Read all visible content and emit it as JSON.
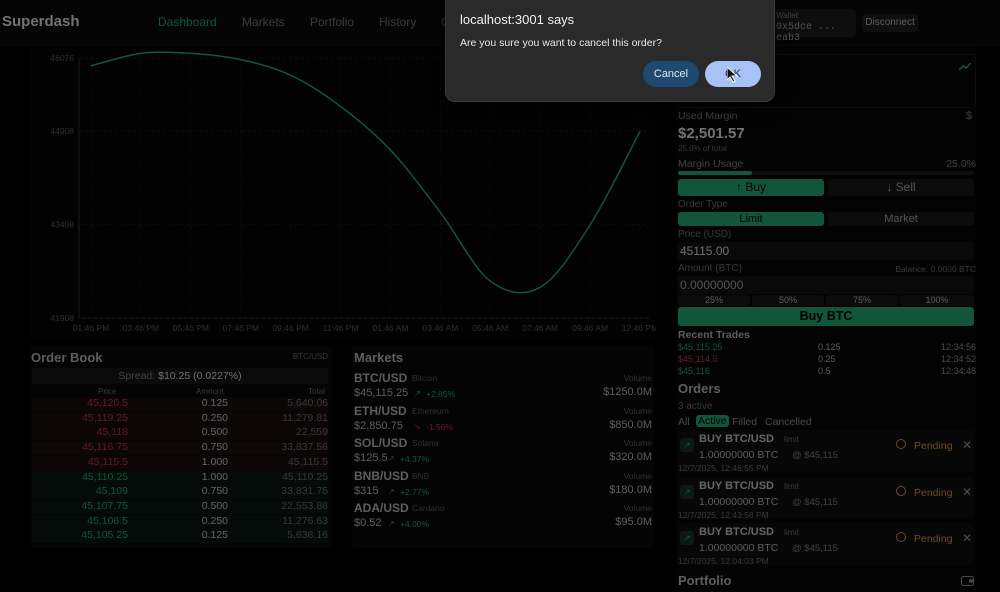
{
  "header": {
    "brand": "Superdash",
    "nav": [
      "Dashboard",
      "Markets",
      "Portfolio",
      "History",
      "G"
    ],
    "wallet_label": "Wallet",
    "wallet_addr": "0x5dce ... eab3",
    "disconnect": "Disconnect"
  },
  "chart": {
    "yticks": [
      "46076",
      "44908",
      "43408",
      "41908"
    ],
    "xticks": [
      "01:46 PM",
      "03:46 PM",
      "05:46 PM",
      "07:46 PM",
      "09:46 PM",
      "11:46 PM",
      "01:46 AM",
      "03:46 AM",
      "05:46 AM",
      "07:46 AM",
      "09:46 AM",
      "12:46 PM"
    ]
  },
  "chart_data": {
    "type": "line",
    "x": [
      "01:46 PM",
      "03:46 PM",
      "05:46 PM",
      "07:46 PM",
      "09:46 PM",
      "11:46 PM",
      "01:46 AM",
      "03:46 AM",
      "05:46 AM",
      "07:46 AM",
      "09:46 AM",
      "12:46 PM"
    ],
    "series": [
      {
        "values": [
          45950,
          46150,
          46150,
          46050,
          45800,
          45300,
          44600,
          43600,
          42500,
          42400,
          43400,
          44900
        ]
      }
    ],
    "ylim": [
      41908,
      46076
    ]
  },
  "orderbook": {
    "title": "Order Book",
    "pair": "BTC/USD",
    "spread_label": "Spread:",
    "spread": "$10.25 (0.0227%)",
    "cols": [
      "Price",
      "Amount",
      "Total"
    ],
    "asks": [
      [
        "45,120.5",
        "0.125",
        "5,640.06"
      ],
      [
        "45,119.25",
        "0.250",
        "11,279.81"
      ],
      [
        "45,118",
        "0.500",
        "22,559"
      ],
      [
        "45,116.75",
        "0.750",
        "33,837.56"
      ],
      [
        "45,115.5",
        "1.000",
        "45,115.5"
      ]
    ],
    "bids": [
      [
        "45,110.25",
        "1.000",
        "45,110.25"
      ],
      [
        "45,109",
        "0.750",
        "33,831.75"
      ],
      [
        "45,107.75",
        "0.500",
        "22,553.88"
      ],
      [
        "45,106.5",
        "0.250",
        "11,276.63"
      ],
      [
        "45,105.25",
        "0.125",
        "5,638.16"
      ]
    ]
  },
  "markets": {
    "title": "Markets",
    "vol_label": "Volume",
    "items": [
      {
        "sym": "BTC/USD",
        "name": "Bitcoin",
        "price": "$45,115.25",
        "chg": "+2.85%",
        "vol": "$1250.0M",
        "up": true
      },
      {
        "sym": "ETH/USD",
        "name": "Ethereum",
        "price": "$2,850.75",
        "chg": "-1.56%",
        "vol": "$850.0M",
        "up": false
      },
      {
        "sym": "SOL/USD",
        "name": "Solana",
        "price": "$125.5",
        "chg": "+4.37%",
        "vol": "$320.0M",
        "up": true
      },
      {
        "sym": "BNB/USD",
        "name": "BNB",
        "price": "$315",
        "chg": "+2.77%",
        "vol": "$180.0M",
        "up": true
      },
      {
        "sym": "ADA/USD",
        "name": "Cardano",
        "price": "$0.52",
        "chg": "+4.00%",
        "vol": "$95.0M",
        "up": true
      }
    ]
  },
  "trade": {
    "used_margin_label": "Used Margin",
    "used_margin": "$2,501.57",
    "pct_total": "25.0% of total",
    "margin_usage_label": "Margin Usage",
    "margin_usage": "25.0%",
    "margin_fill": 0.25,
    "buy": "Buy",
    "sell": "Sell",
    "order_type": "Order Type",
    "limit": "Limit",
    "market": "Market",
    "price_label": "Price (USD)",
    "price": "45115.00",
    "amount_label": "Amount (BTC)",
    "balance": "Balance: 0.0000 BTC",
    "amount": "0.00000000",
    "pcts": [
      "25%",
      "50%",
      "75%",
      "100%"
    ],
    "submit": "Buy BTC",
    "recent": "Recent Trades",
    "trades": [
      [
        "$45,115.25",
        "0.125",
        "12:34:56",
        "g"
      ],
      [
        "$45,114.5",
        "0.25",
        "12:34:52",
        "r"
      ],
      [
        "$45,116",
        "0.5",
        "12:34:48",
        "g"
      ]
    ]
  },
  "orders": {
    "title": "Orders",
    "count": "3 active",
    "tabs": [
      "All",
      "Active",
      "Filled",
      "Cancelled"
    ],
    "items": [
      {
        "title": "BUY BTC/USD",
        "type": "limit",
        "qty": "1.00000000 BTC",
        "at": "@ $45,115",
        "time": "12/7/2025, 12:46:55 PM",
        "status": "Pending"
      },
      {
        "title": "BUY BTC/USD",
        "type": "limit",
        "qty": "1.00000000 BTC",
        "at": "@ $45,115",
        "time": "12/7/2025, 12:43:58 PM",
        "status": "Pending"
      },
      {
        "title": "BUY BTC/USD",
        "type": "limit",
        "qty": "1.00000000 BTC",
        "at": "@ $45,115",
        "time": "12/7/2025, 12:04:03 PM",
        "status": "Pending"
      }
    ]
  },
  "portfolio": {
    "title": "Portfolio",
    "dollar": "$"
  },
  "dialog": {
    "title": "localhost:3001 says",
    "message": "Are you sure you want to cancel this order?",
    "cancel": "Cancel",
    "ok": "OK"
  },
  "colors": {
    "accent": "#1f9c6b",
    "red": "#b23345",
    "dialog_blue": "#a9c2f5",
    "dialog_cancel": "#1d4a6e"
  }
}
